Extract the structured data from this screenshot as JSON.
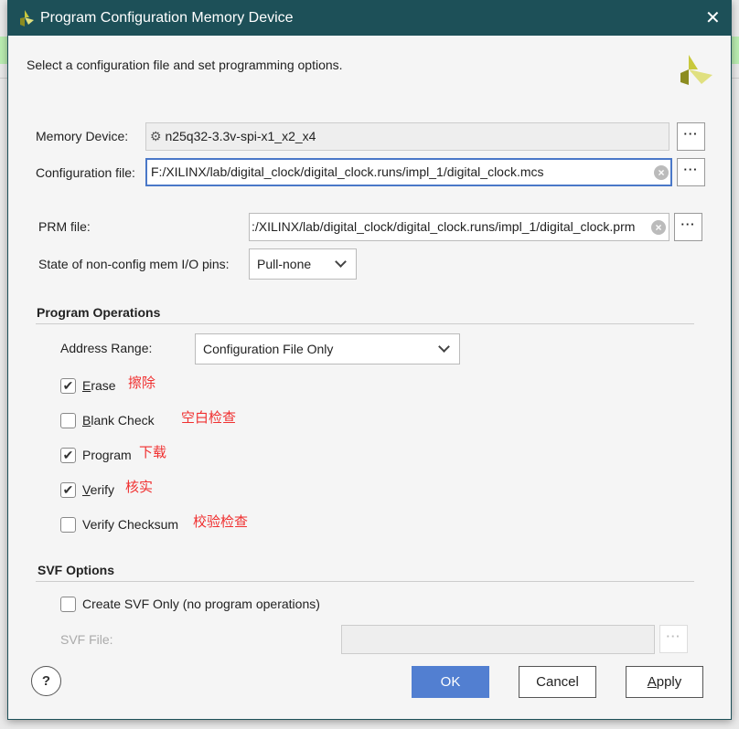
{
  "window": {
    "title": "Program Configuration Memory Device",
    "close": "✕"
  },
  "description": "Select a configuration file and set programming options.",
  "memory_device": {
    "label": "Memory Device:",
    "value": "n25q32-3.3v-spi-x1_x2_x4",
    "browse": "···"
  },
  "config_file": {
    "label": "Configuration file:",
    "mnemonic": 1,
    "value": "F:/XILINX/lab/digital_clock/digital_clock.runs/impl_1/digital_clock.mcs",
    "browse": "···"
  },
  "prm_file": {
    "label": "PRM file:",
    "mnemonic": 2,
    "value": ":/XILINX/lab/digital_clock/digital_clock.runs/impl_1/digital_clock.prm",
    "browse": "···"
  },
  "pin_state": {
    "label": "State of non-config mem I/O pins:",
    "value": "Pull-none"
  },
  "program_operations": {
    "heading": "Program Operations",
    "address_range": {
      "label": "Address Range:",
      "value": "Configuration File Only"
    },
    "options": [
      {
        "label": "Erase",
        "mnemonic": 0,
        "checked": true,
        "note": "擦除"
      },
      {
        "label": "Blank Check",
        "mnemonic": 0,
        "checked": false,
        "note": "空白检查"
      },
      {
        "label": "Program",
        "mnemonic": -1,
        "checked": true,
        "note": "下载"
      },
      {
        "label": "Verify",
        "mnemonic": 0,
        "checked": true,
        "note": "核实"
      },
      {
        "label": "Verify Checksum",
        "mnemonic": 7,
        "checked": false,
        "note": "校验检查"
      }
    ]
  },
  "svf_options": {
    "heading": "SVF Options",
    "create_svf": {
      "label": "Create SVF Only (no program operations)",
      "mnemonic": 7,
      "checked": false
    },
    "svf_file": {
      "label": "SVF File:",
      "value": "",
      "browse": "···"
    }
  },
  "buttons": {
    "help": "?",
    "ok": "OK",
    "cancel": "Cancel",
    "apply": "Apply"
  },
  "colors": {
    "titlebar": "#1d5058",
    "accent": "#527fd1",
    "note": "#f03030"
  }
}
